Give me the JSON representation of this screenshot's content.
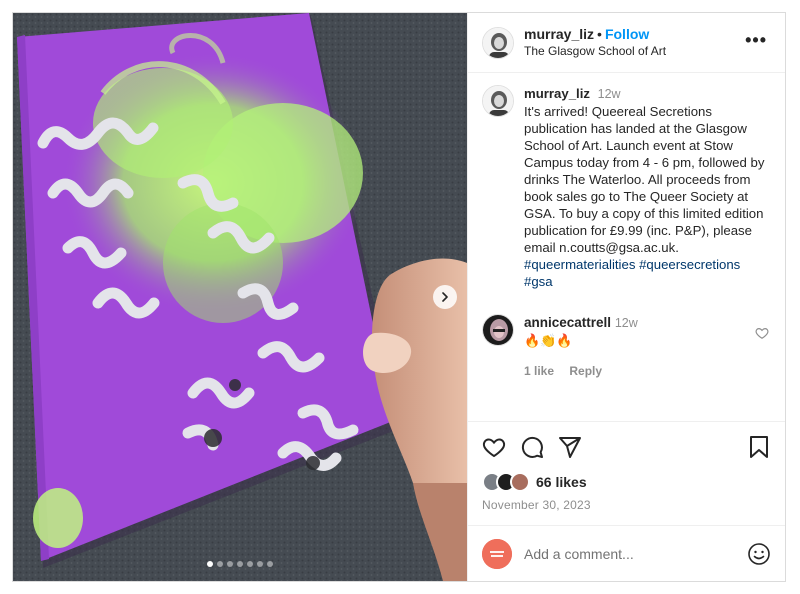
{
  "post": {
    "username": "murray_liz",
    "follow_label": "Follow",
    "separator": "•",
    "location": "The Glasgow School of Art",
    "more_icon": "more-horizontal-icon",
    "more_label": "•••"
  },
  "caption": {
    "username": "murray_liz",
    "time": "12w",
    "text": "It's arrived! Queereal Secretions publication has landed at the Glasgow School of Art. Launch event at Stow Campus today from 4 - 6 pm, followed by drinks The Waterloo. All proceeds from book sales go to The Queer Society at GSA. To buy a copy of this limited edition publication for £9.99 (inc. P&P), please email n.coutts@gsa.ac.uk.",
    "hashtags": [
      "#queermaterialities",
      "#queersecretions",
      "#gsa"
    ]
  },
  "comments": [
    {
      "username": "annicecattrell",
      "time": "12w",
      "text": "🔥👏🔥",
      "likes_label": "1 like",
      "reply_label": "Reply"
    }
  ],
  "media": {
    "current_slide": 1,
    "total_slides": 7,
    "next_icon": "chevron-right-icon"
  },
  "actions": {
    "like_icon": "heart-icon",
    "comment_icon": "comment-icon",
    "share_icon": "paper-plane-icon",
    "save_icon": "bookmark-icon",
    "likes": "66 likes",
    "date": "November 30, 2023"
  },
  "composer": {
    "placeholder": "Add a comment...",
    "emoji_icon": "smile-icon"
  },
  "colors": {
    "accent": "#0095f6",
    "hashtag": "#00376b",
    "muted": "#8e8e8e",
    "cover_purple": "#a04ad9",
    "flower_green": "#a8ef64"
  }
}
